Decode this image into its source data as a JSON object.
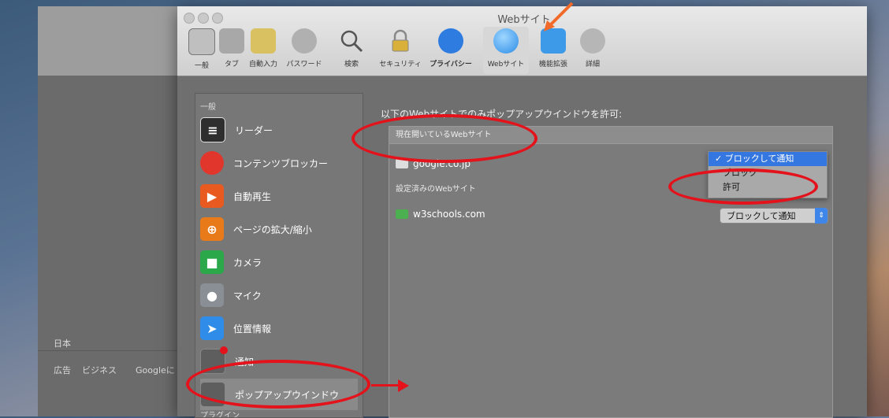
{
  "window": {
    "title": "Webサイト"
  },
  "toolbar": {
    "items": [
      {
        "label": "一般",
        "icon": "general-icon"
      },
      {
        "label": "タブ",
        "icon": "tabs-icon"
      },
      {
        "label": "自動入力",
        "icon": "autofill-icon"
      },
      {
        "label": "パスワード",
        "icon": "key-icon"
      },
      {
        "label": "検索",
        "icon": "search-icon"
      },
      {
        "label": "セキュリティ",
        "icon": "lock-icon"
      },
      {
        "label": "プライバシー",
        "icon": "hand-icon"
      },
      {
        "label": "Webサイト",
        "icon": "globe-icon"
      },
      {
        "label": "機能拡張",
        "icon": "puzzle-icon"
      },
      {
        "label": "詳細",
        "icon": "gear-icon"
      }
    ]
  },
  "background_window": {
    "footer_country": "日本",
    "footer_links": [
      "広告",
      "ビジネス",
      "Googleに"
    ]
  },
  "sidebar": {
    "section_general": "一般",
    "items": [
      {
        "label": "リーダー",
        "icon": "reader-icon",
        "color": "#333333"
      },
      {
        "label": "コンテンツブロッカー",
        "icon": "content-blocker-icon",
        "color": "#e0362c"
      },
      {
        "label": "自動再生",
        "icon": "autoplay-icon",
        "color": "#e85a20"
      },
      {
        "label": "ページの拡大/縮小",
        "icon": "zoom-icon",
        "color": "#e87a1a"
      },
      {
        "label": "カメラ",
        "icon": "camera-icon",
        "color": "#2aa84a"
      },
      {
        "label": "マイク",
        "icon": "microphone-icon",
        "color": "#8a8f96"
      },
      {
        "label": "位置情報",
        "icon": "location-icon",
        "color": "#2f8ce8"
      },
      {
        "label": "通知",
        "icon": "notification-icon",
        "color": "#6a6a6a"
      },
      {
        "label": "ポップアップウインドウ",
        "icon": "popup-window-icon",
        "color": "#6a6a6a"
      }
    ],
    "section_plugins": "プラグイン"
  },
  "panel": {
    "heading": "以下のWebサイトでのみポップアップウインドウを許可:",
    "current_sites_header": "現在開いているWebサイト",
    "current_site": "google.co.jp",
    "configured_label": "設定済みのWebサイト",
    "configured_site": "w3schools.com",
    "dropdown_options": [
      {
        "label": "ブロックして通知",
        "checked": true
      },
      {
        "label": "ブロック",
        "checked": false
      },
      {
        "label": "許可",
        "checked": false
      }
    ],
    "checkmark": "✓",
    "configured_site_setting": "ブロックして通知"
  },
  "colors": {
    "annotation_red": "#e3121b",
    "selection_blue": "#3477e0"
  }
}
